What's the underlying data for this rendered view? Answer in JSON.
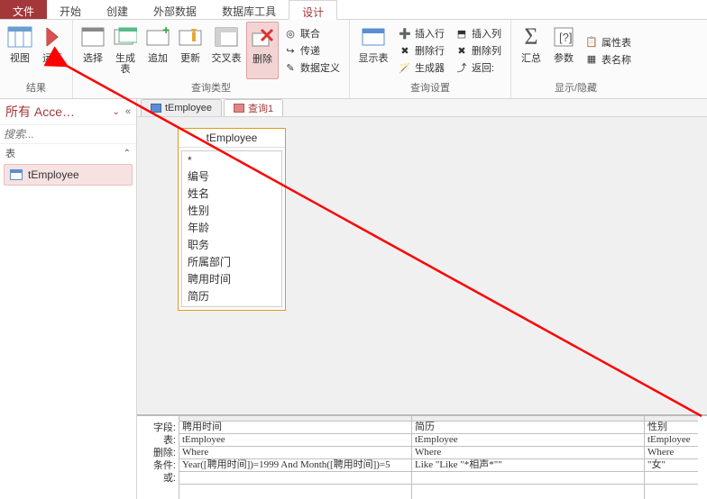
{
  "ribbon": {
    "tabs": [
      "文件",
      "开始",
      "创建",
      "外部数据",
      "数据库工具",
      "设计"
    ],
    "active": 5,
    "groups": {
      "results": {
        "label": "结果",
        "view": "视图",
        "run": "运行"
      },
      "qtype": {
        "label": "查询类型",
        "select": "选择",
        "make": "生成表",
        "append": "追加",
        "update": "更新",
        "crosstab": "交叉表",
        "delete": "删除",
        "union": "联合",
        "passthrough": "传递",
        "datadef": "数据定义"
      },
      "qsetup": {
        "label": "查询设置",
        "showtable": "显示表",
        "insrow": "插入行",
        "delrow": "删除行",
        "builder": "生成器",
        "inscol": "插入列",
        "delcol": "删除列",
        "return": "返回:"
      },
      "showhide": {
        "label": "显示/隐藏",
        "totals": "汇总",
        "params": "参数",
        "propsheet": "属性表",
        "tablenames": "表名称"
      }
    }
  },
  "nav": {
    "title": "所有 Acce…",
    "search_ph": "搜索...",
    "section": "表",
    "items": [
      "tEmployee"
    ]
  },
  "docs": {
    "tabs": [
      "tEmployee",
      "查询1"
    ],
    "active": 1
  },
  "fieldbox": {
    "title": "tEmployee",
    "fields": [
      "*",
      "编号",
      "姓名",
      "性别",
      "年龄",
      "职务",
      "所属部门",
      "聘用时间",
      "简历"
    ]
  },
  "grid": {
    "row_labels": [
      "字段:",
      "表:",
      "删除:",
      "条件:",
      "或:"
    ],
    "cols": [
      {
        "field": "聘用时间",
        "table": "tEmployee",
        "delete": "Where",
        "criteria": "Year([聘用时间])=1999 And Month([聘用时间])=5",
        "or": ""
      },
      {
        "field": "简历",
        "table": "tEmployee",
        "delete": "Where",
        "criteria": "Like \"Like \"*相声*\"\"",
        "or": ""
      },
      {
        "field": "性别",
        "table": "tEmployee",
        "delete": "Where",
        "criteria": "\"女\"",
        "or": ""
      }
    ]
  }
}
